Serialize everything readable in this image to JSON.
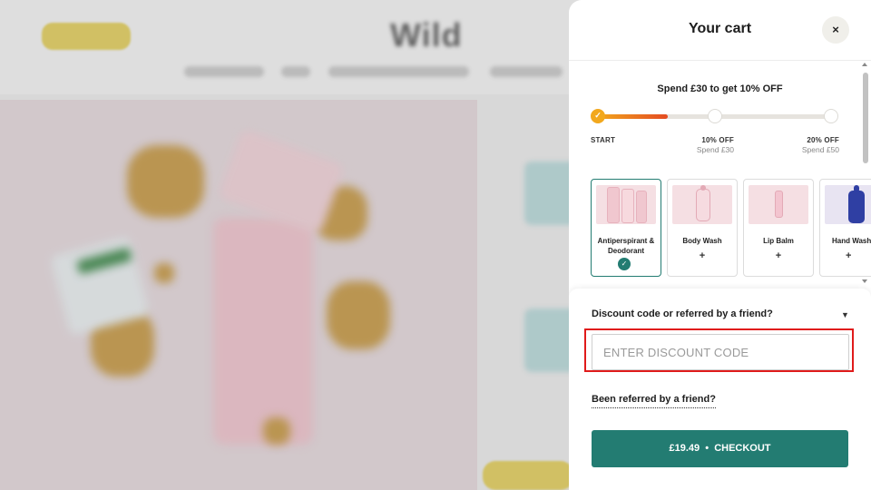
{
  "background": {
    "logo": "Wild"
  },
  "cart": {
    "title": "Your cart",
    "close_label": "×",
    "spend_message": "Spend £30 to get 10% OFF",
    "tiers": [
      {
        "label": "START",
        "sub": ""
      },
      {
        "label": "10% OFF",
        "sub": "Spend £30"
      },
      {
        "label": "20% OFF",
        "sub": "Spend £50"
      }
    ],
    "start_check": "✓",
    "progress_fraction": 0.3,
    "products": [
      {
        "name": "Antiperspirant & Deodorant",
        "selected": true,
        "mark": "✓"
      },
      {
        "name": "Body Wash",
        "selected": false,
        "mark": "+"
      },
      {
        "name": "Lip Balm",
        "selected": false,
        "mark": "+"
      },
      {
        "name": "Hand Wash",
        "selected": false,
        "mark": "+"
      }
    ],
    "discount": {
      "toggle_label": "Discount code or referred by a friend?",
      "chevron": "⌄",
      "placeholder": "ENTER DISCOUNT CODE",
      "value": ""
    },
    "referred_label": "Been referred by a friend?",
    "checkout": {
      "price": "£19.49",
      "separator": "•",
      "label": "CHECKOUT",
      "full": "£19.49  •  CHECKOUT"
    }
  },
  "colors": {
    "accent": "#237c72",
    "highlight": "#e01b1b",
    "progress_start": "#f2a81d",
    "progress_end": "#e44b22"
  }
}
